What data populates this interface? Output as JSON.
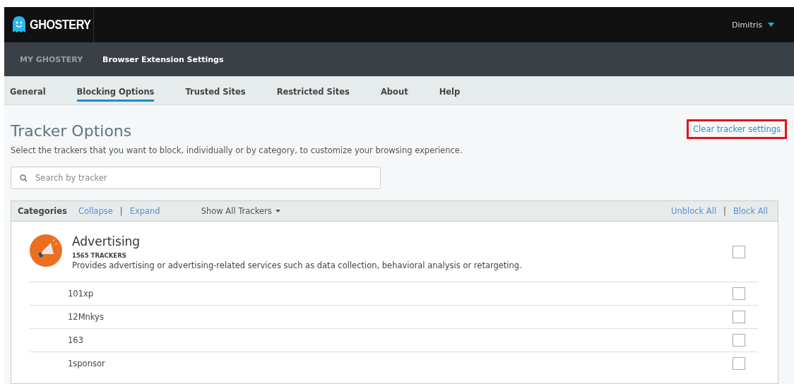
{
  "header": {
    "logo": "GHOSTERY",
    "user": "Dimitris"
  },
  "nav": [
    {
      "label": "MY GHOSTERY",
      "selected": false
    },
    {
      "label": "Browser Extension Settings",
      "selected": true
    }
  ],
  "tabs": [
    {
      "label": "General",
      "selected": false
    },
    {
      "label": "Blocking Options",
      "selected": true
    },
    {
      "label": "Trusted Sites",
      "selected": false
    },
    {
      "label": "Restricted Sites",
      "selected": false
    },
    {
      "label": "About",
      "selected": false
    },
    {
      "label": "Help",
      "selected": false
    }
  ],
  "title": "Tracker Options",
  "clear_link": {
    "label": "Clear tracker settings",
    "highlighted": true
  },
  "description": "Select the trackers that you want to block, individually or by category, to customize your browsing experience.",
  "search": {
    "placeholder": "Search by tracker"
  },
  "toolbar": {
    "label": "Categories",
    "collapse": "Collapse",
    "separator": "|",
    "expand": "Expand",
    "filter": "Show All Trackers",
    "unblock_all": "Unblock All",
    "separator_2": "|",
    "block_all": "Block All"
  },
  "category": {
    "name": "Advertising",
    "count": "1565 TRACKERS",
    "description": "Provides advertising or advertising-related services such as data collection, behavioral analysis or retargeting.",
    "checked": false,
    "trackers": [
      {
        "name": "101xp",
        "checked": false
      },
      {
        "name": "12Mnkys",
        "checked": false
      },
      {
        "name": "163",
        "checked": false
      },
      {
        "name": "1sponsor",
        "checked": false
      }
    ]
  }
}
